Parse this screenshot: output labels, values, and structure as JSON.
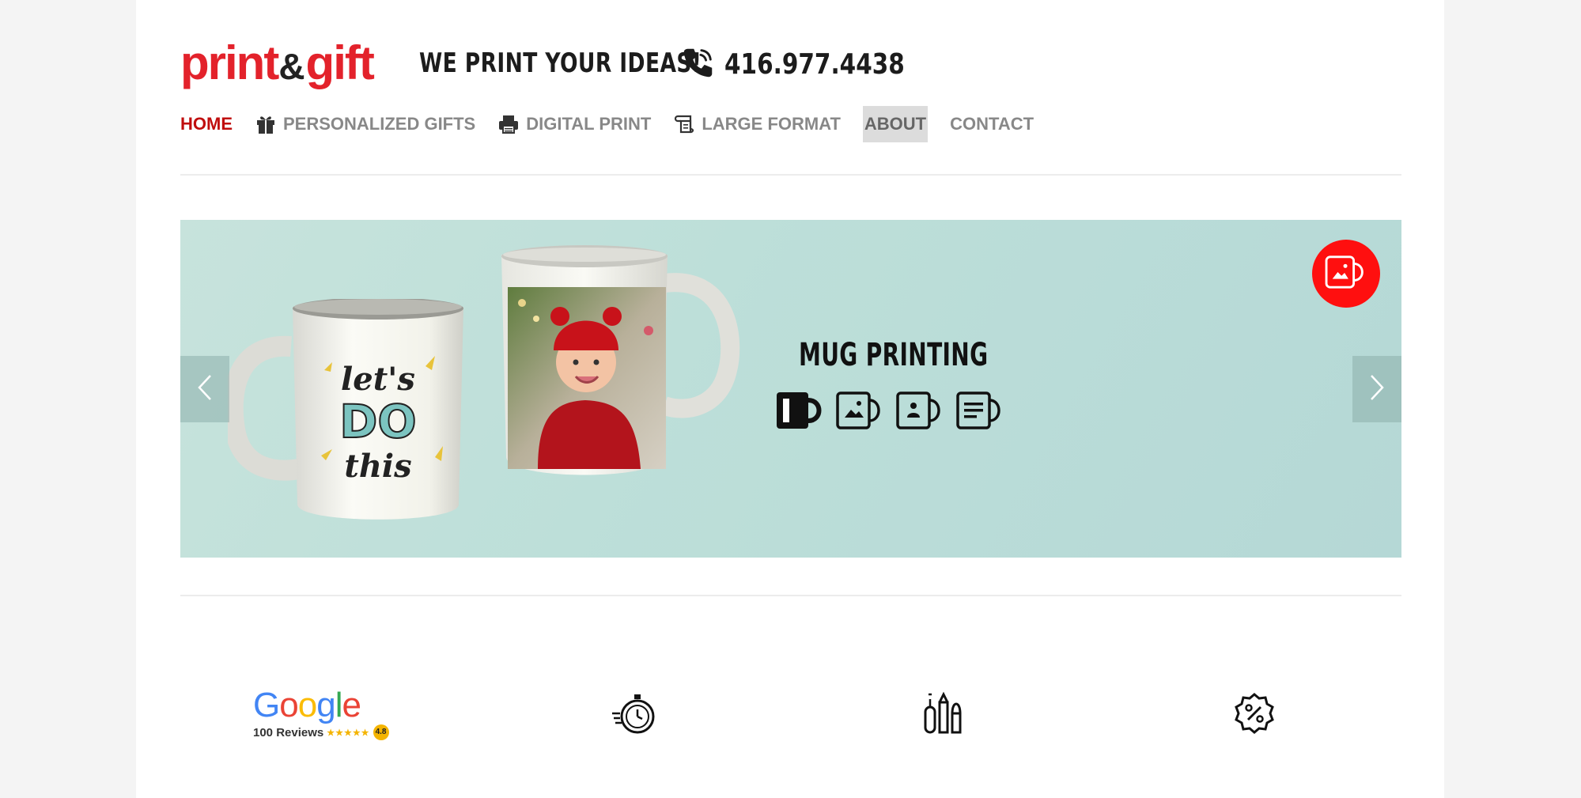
{
  "brand": {
    "logo_print": "print",
    "logo_amp": "&",
    "logo_gift": "gift",
    "tagline": "WE PRINT YOUR IDEAS!",
    "phone": "416.977.4438"
  },
  "nav": {
    "home": "HOME",
    "personalized_gifts": "PERSONALIZED GIFTS",
    "digital_print": "DIGITAL PRINT",
    "large_format": "LARGE FORMAT",
    "about": "ABOUT",
    "contact": "CONTACT"
  },
  "hero": {
    "title": "MUG PRINTING",
    "mug_text_top": "let's",
    "mug_text_mid": "DO",
    "mug_text_bottom": "this"
  },
  "features": {
    "google_word": "Google",
    "google_reviews": "100 Reviews",
    "google_stars": "★★★★★",
    "google_rating": "4.8",
    "icons": [
      "stopwatch-icon",
      "design-tools-icon",
      "discount-badge-icon"
    ]
  },
  "colors": {
    "brand_red": "#e3222b",
    "nav_active": "#c00d0d",
    "hero_bg": "#bddfd9",
    "badge_red": "#ff0f0f"
  }
}
